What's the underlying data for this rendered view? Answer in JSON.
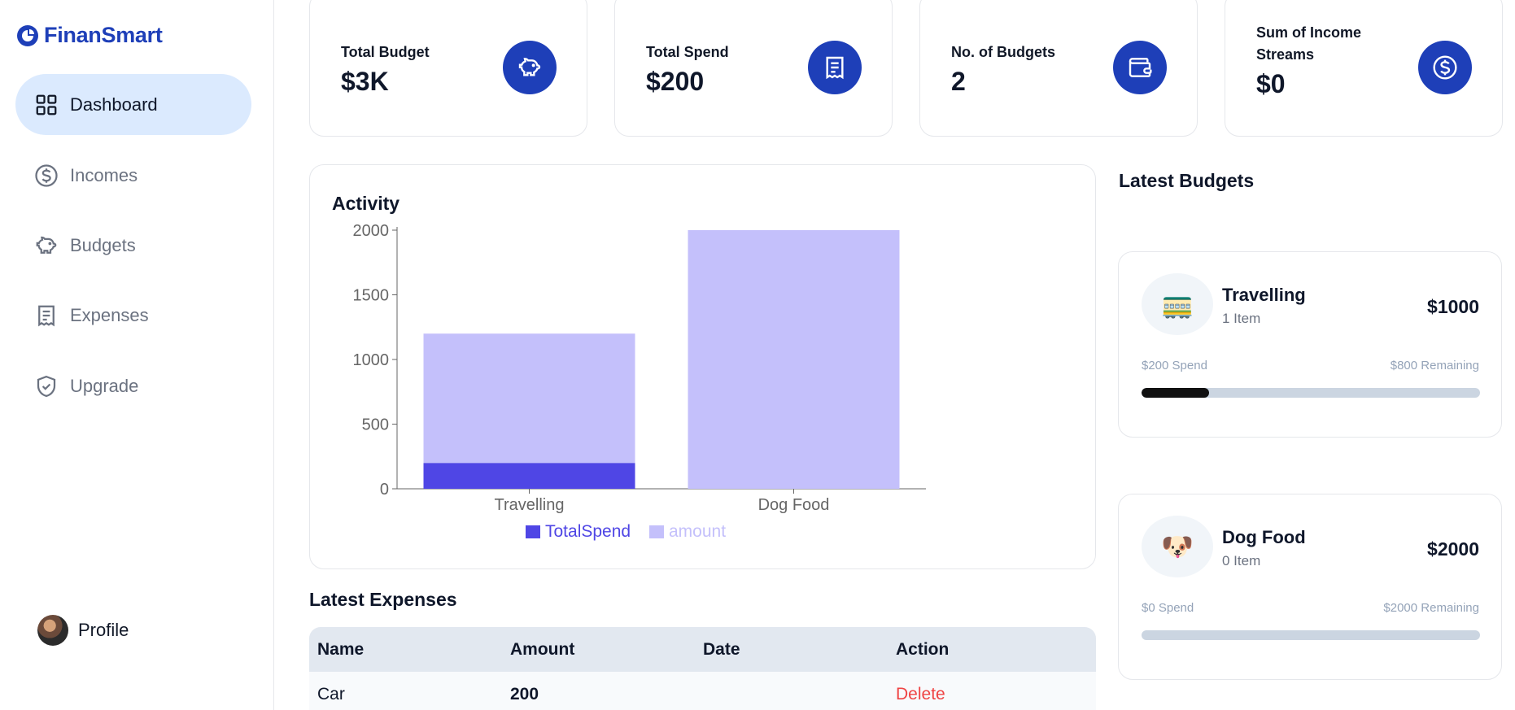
{
  "brand": {
    "name": "FinanSmart"
  },
  "sidebar": {
    "items": [
      {
        "label": "Dashboard",
        "icon": "grid-icon",
        "active": true
      },
      {
        "label": "Incomes",
        "icon": "dollar-circle-icon"
      },
      {
        "label": "Budgets",
        "icon": "piggy-bank-icon"
      },
      {
        "label": "Expenses",
        "icon": "receipt-icon"
      },
      {
        "label": "Upgrade",
        "icon": "shield-check-icon"
      }
    ],
    "profile": {
      "label": "Profile"
    }
  },
  "stats": [
    {
      "label": "Total Budget",
      "value": "$3K",
      "icon": "piggy-bank-icon"
    },
    {
      "label": "Total Spend",
      "value": "$200",
      "icon": "receipt-icon"
    },
    {
      "label": "No. of Budgets",
      "value": "2",
      "icon": "wallet-icon"
    },
    {
      "label": "Sum of Income Streams",
      "value": "$0",
      "icon": "dollar-circle-icon"
    }
  ],
  "activity": {
    "title": "Activity"
  },
  "chart_data": {
    "type": "bar",
    "categories": [
      "Travelling",
      "Dog Food"
    ],
    "series": [
      {
        "name": "TotalSpend",
        "values": [
          200,
          0
        ],
        "color": "#4f46e5"
      },
      {
        "name": "amount",
        "values": [
          1000,
          2000
        ],
        "color": "#c4c0fb"
      }
    ],
    "yticks": [
      0,
      500,
      1000,
      1500,
      2000
    ],
    "ylim": [
      0,
      2000
    ],
    "stacked": true,
    "legend": "bottom",
    "grid": false
  },
  "expenses": {
    "title": "Latest Expenses",
    "columns": [
      "Name",
      "Amount",
      "Date",
      "Action"
    ],
    "rows": [
      {
        "name": "Car",
        "amount": "200",
        "date": "",
        "action": "Delete"
      }
    ]
  },
  "budgets": {
    "title": "Latest Budgets",
    "items": [
      {
        "emoji": "🚃",
        "name": "Travelling",
        "items": "1 Item",
        "amount": "$1000",
        "spend": "$200 Spend",
        "remaining": "$800 Remaining",
        "progress": 0.2
      },
      {
        "emoji": "🐶",
        "name": "Dog Food",
        "items": "0 Item",
        "amount": "$2000",
        "spend": "$0 Spend",
        "remaining": "$2000 Remaining",
        "progress": 0
      }
    ]
  },
  "colors": {
    "brand": "#1e3fb8",
    "active_nav": "#dbeafe",
    "delete": "#ef4444"
  }
}
